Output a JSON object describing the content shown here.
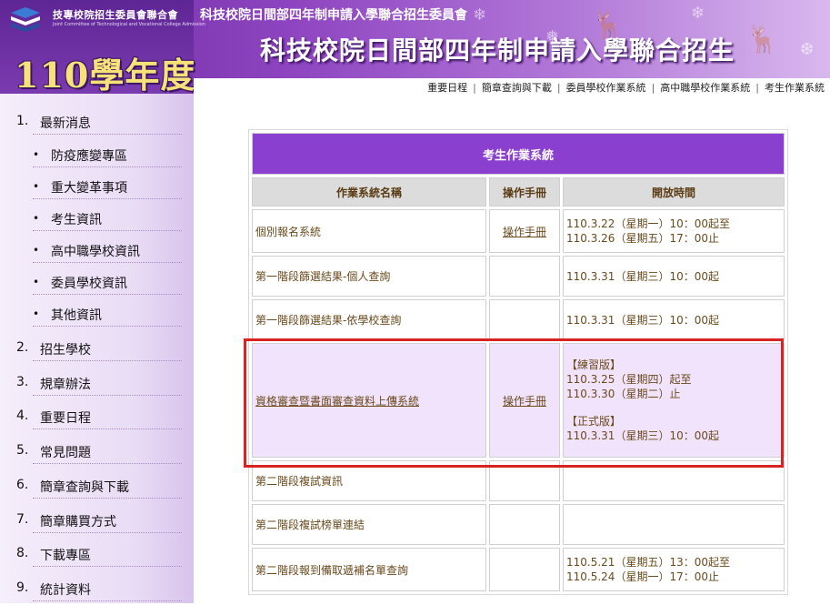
{
  "header": {
    "org_name": "技專校院招生委員會聯合會",
    "org_sub": "Joint Committee of Technological and Vocational College Admission",
    "year_title": "110學年度",
    "small_title": "科技校院日間部四年制申請入學聯合招生委員會",
    "big_title": "科技校院日間部四年制申請入學聯合招生"
  },
  "topnav": {
    "items": [
      "重要日程",
      "簡章查詢與下載",
      "委員學校作業系統",
      "高中職學校作業系統",
      "考生作業系統"
    ],
    "separator": "|"
  },
  "sidebar": {
    "items": [
      {
        "num": "1.",
        "label": "最新消息"
      },
      {
        "bullet": "•",
        "label": "防疫應變專區"
      },
      {
        "bullet": "•",
        "label": "重大變革事項"
      },
      {
        "bullet": "•",
        "label": "考生資訊"
      },
      {
        "bullet": "•",
        "label": "高中職學校資訊"
      },
      {
        "bullet": "•",
        "label": "委員學校資訊"
      },
      {
        "bullet": "•",
        "label": "其他資訊"
      },
      {
        "num": "2.",
        "label": "招生學校"
      },
      {
        "num": "3.",
        "label": "規章辦法"
      },
      {
        "num": "4.",
        "label": "重要日程"
      },
      {
        "num": "5.",
        "label": "常見問題"
      },
      {
        "num": "6.",
        "label": "簡章查詢與下載"
      },
      {
        "num": "7.",
        "label": "簡章購買方式"
      },
      {
        "num": "8.",
        "label": "下載專區"
      },
      {
        "num": "9.",
        "label": "統計資料"
      }
    ]
  },
  "table": {
    "caption": "考生作業系統",
    "headers": [
      "作業系統名稱",
      "操作手冊",
      "開放時間"
    ],
    "rows": [
      {
        "name": "個別報名系統",
        "manual": "操作手冊",
        "time": [
          "110.3.22（星期一）10：00起至",
          "110.3.26（星期五）17：00止"
        ]
      },
      {
        "name": "第一階段篩選結果-個人查詢",
        "manual": "",
        "time": [
          "110.3.31（星期三）10：00起"
        ]
      },
      {
        "name": "第一階段篩選結果-依學校查詢",
        "manual": "",
        "time": [
          "110.3.31（星期三）10：00起"
        ]
      },
      {
        "name": "資格審查暨書面審查資料上傳系統",
        "manual": "操作手冊",
        "time": [
          "【練習版】",
          "110.3.25（星期四）起至",
          "110.3.30（星期二）止",
          "",
          "【正式版】",
          "110.3.31（星期三）10：00起"
        ]
      },
      {
        "name": "第二階段複試資訊",
        "manual": "",
        "time": []
      },
      {
        "name": "第二階段複試榜單連結",
        "manual": "",
        "time": []
      },
      {
        "name": "第二階段報到備取遞補名單查詢",
        "manual": "",
        "time": [
          "110.5.21（星期五）13：00起至",
          "110.5.24（星期一）17：00止"
        ]
      }
    ]
  },
  "colors": {
    "header_purple": "#8e44c0",
    "caption_purple": "#8a3fcf",
    "highlight_row": "#f1e3fb",
    "red_box": "#d82323",
    "year_gold": "#f7e27a"
  }
}
